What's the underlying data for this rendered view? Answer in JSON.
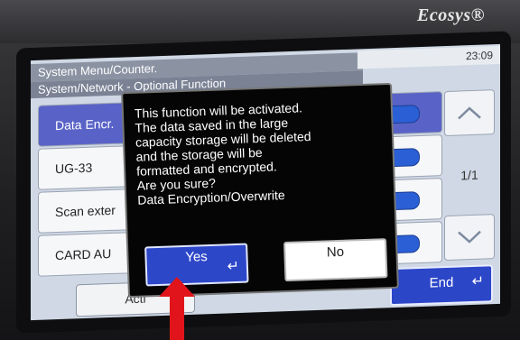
{
  "device": {
    "brand": "Ecosys®"
  },
  "screen": {
    "header_line1": "System Menu/Counter.",
    "header_line2": "System/Network - Optional Function",
    "clock": "23:09",
    "rows": [
      {
        "label": "Data Encr.",
        "selected": true
      },
      {
        "label": "UG-33",
        "selected": false
      },
      {
        "label": "Scan exter",
        "selected": false
      },
      {
        "label": "CARD AU",
        "selected": false
      }
    ],
    "pager": "1/1",
    "activate_label": "Acti",
    "end_label": "End"
  },
  "dialog": {
    "message": "This function will be activated.\nThe data saved in the large\ncapacity storage will be deleted\nand the storage will be\nformatted and encrypted.\nAre you sure?\nData Encryption/Overwrite",
    "yes_label": "Yes",
    "no_label": "No"
  },
  "colors": {
    "accent_blue": "#2d47c9",
    "selected_row": "#5963c7",
    "pointer_red": "#e2141b"
  }
}
